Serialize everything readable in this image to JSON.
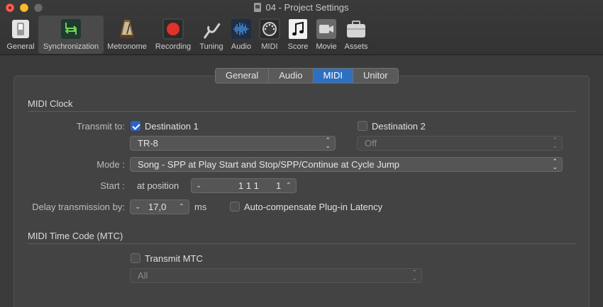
{
  "window": {
    "title": "04 - Project Settings"
  },
  "toolbar": {
    "items": [
      {
        "label": "General",
        "icon": "switch-icon"
      },
      {
        "label": "Synchronization",
        "icon": "sync-arrows-icon"
      },
      {
        "label": "Metronome",
        "icon": "metronome-icon"
      },
      {
        "label": "Recording",
        "icon": "record-icon"
      },
      {
        "label": "Tuning",
        "icon": "tuning-fork-icon"
      },
      {
        "label": "Audio",
        "icon": "waveform-icon"
      },
      {
        "label": "MIDI",
        "icon": "midi-port-icon"
      },
      {
        "label": "Score",
        "icon": "music-note-icon"
      },
      {
        "label": "Movie",
        "icon": "camera-icon"
      },
      {
        "label": "Assets",
        "icon": "briefcase-icon"
      }
    ],
    "selected": "Synchronization"
  },
  "tabs": [
    "General",
    "Audio",
    "MIDI",
    "Unitor"
  ],
  "active_tab": "MIDI",
  "midi_clock": {
    "title": "MIDI Clock",
    "transmit_label": "Transmit to:",
    "dest1": {
      "label": "Destination 1",
      "checked": true,
      "port": "TR-8"
    },
    "dest2": {
      "label": "Destination 2",
      "checked": false,
      "port": "Off"
    },
    "mode_label": "Mode :",
    "mode_value": "Song - SPP at Play Start and Stop/SPP/Continue at Cycle Jump",
    "start_label": "Start :",
    "start_text": "at position",
    "start_position": "1 1 1",
    "start_position_tick": "1",
    "delay_label": "Delay transmission by:",
    "delay_value": "17,0",
    "delay_unit": "ms",
    "auto_comp_label": "Auto-compensate Plug-in Latency"
  },
  "mtc": {
    "title": "MIDI Time Code (MTC)",
    "transmit_label": "Transmit MTC",
    "port": "All"
  },
  "colors": {
    "accent": "#2f6fc0",
    "checkbox": "#2a63c9",
    "close": "#fc5f57",
    "minimize": "#fdbc2e",
    "record": "#e0312b"
  }
}
